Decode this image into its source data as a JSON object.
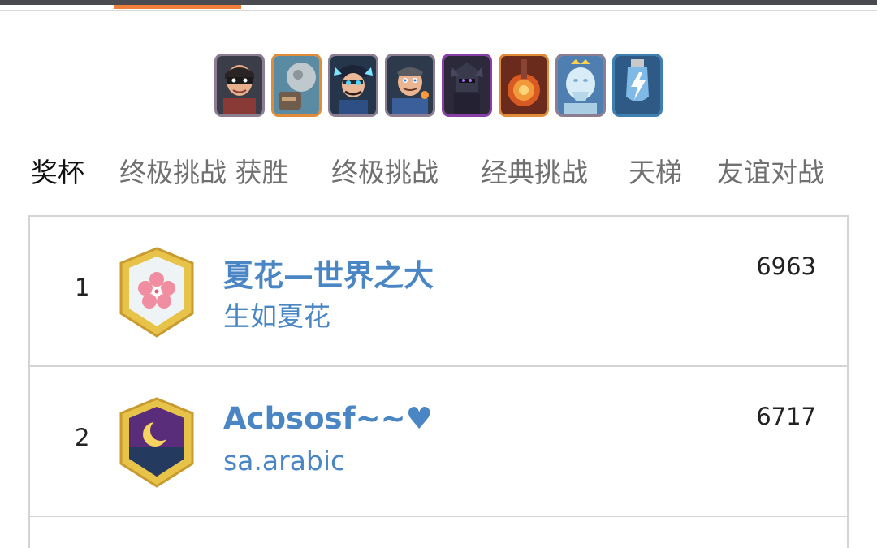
{
  "deck": {
    "cards": [
      {
        "name": "bandit-card",
        "rarity": "legendary"
      },
      {
        "name": "giant-skeleton-card",
        "rarity": "rare"
      },
      {
        "name": "electro-wizard-card",
        "rarity": "legendary"
      },
      {
        "name": "magician-card",
        "rarity": "legendary"
      },
      {
        "name": "pekka-card",
        "rarity": "epic"
      },
      {
        "name": "fireball-card",
        "rarity": "rare"
      },
      {
        "name": "ice-golem-card",
        "rarity": "legendary"
      },
      {
        "name": "zap-card",
        "rarity": "common"
      }
    ]
  },
  "tabs": [
    {
      "label": "奖杯",
      "active": true
    },
    {
      "label": "终极挑战 获胜",
      "active": false
    },
    {
      "label": "终极挑战",
      "active": false
    },
    {
      "label": "经典挑战",
      "active": false
    },
    {
      "label": "天梯",
      "active": false
    },
    {
      "label": "友谊对战",
      "active": false
    }
  ],
  "leaderboard": {
    "rows": [
      {
        "rank": "1",
        "player": "夏花—世界之大",
        "clan": "生如夏花",
        "trophies": "6963",
        "badge": "cherry-blossom-badge",
        "badge_color": "#e9f0f4"
      },
      {
        "rank": "2",
        "player": "Acbsosf~~♥",
        "clan": "sa.arabic",
        "trophies": "6717",
        "badge": "moon-badge",
        "badge_color": "#5a2d7a"
      }
    ]
  },
  "colors": {
    "accent": "#f07f3c",
    "link": "#4a86c4",
    "tab_inactive": "#707070"
  }
}
